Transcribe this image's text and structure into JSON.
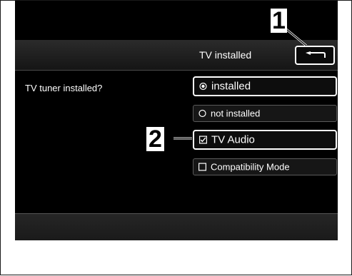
{
  "header": {
    "title": "TV installed",
    "back_icon": "back-arrow-icon"
  },
  "question": "TV tuner installed?",
  "options": [
    {
      "label": "installed",
      "indicator": "radio-selected-icon"
    },
    {
      "label": "not installed",
      "indicator": "radio-unselected-icon"
    },
    {
      "label": "TV Audio",
      "indicator": "checkbox-checked-icon"
    },
    {
      "label": "Compatibility Mode",
      "indicator": "checkbox-unchecked-icon"
    }
  ],
  "callouts": {
    "one": "1",
    "two": "2"
  },
  "colors": {
    "screen_bg": "#000000",
    "text": "#ffffff",
    "selected_border": "#ffffff",
    "option_border": "#5a5a5a"
  }
}
